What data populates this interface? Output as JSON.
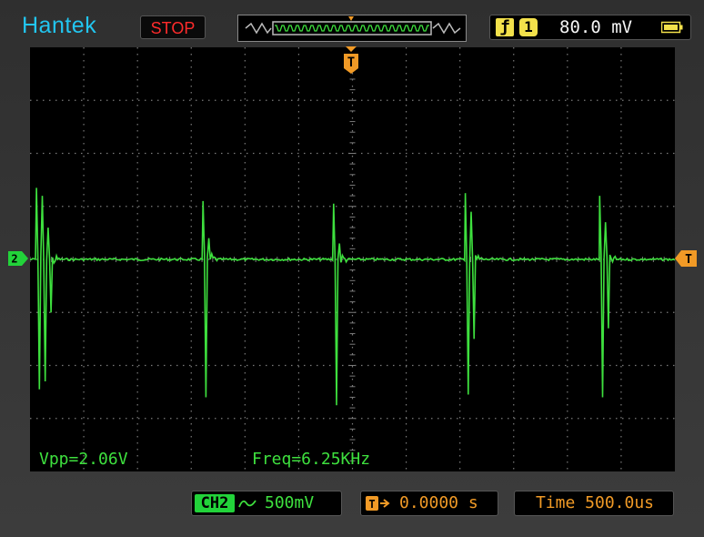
{
  "header": {
    "brand": "Hantek",
    "run_state": "STOP",
    "trigger": {
      "edge_symbol": "ƒ",
      "source": "1",
      "level": "80.0 mV",
      "battery_icon": "battery-icon"
    }
  },
  "screen": {
    "measurements": {
      "vpp": "Vpp=2.06V",
      "freq": "Freq=6.25KHz"
    },
    "channel_marker": "2",
    "trigger_level_marker": "T",
    "trigger_position_marker": "T"
  },
  "status_bar": {
    "channel": {
      "label": "CH2",
      "coupling_icon": "ac-coupling-icon",
      "scale": "500mV"
    },
    "trigger_offset": {
      "icon": "trigger-offset-icon",
      "value": "0.0000 s"
    },
    "timebase": "Time 500.0us"
  },
  "colors": {
    "trace": "#3ee03e",
    "brand": "#22c6f0",
    "stop": "#ff2b2b",
    "trigger": "#f19a26",
    "grid": "#7a7a7a"
  },
  "chart_data": {
    "type": "line",
    "grid": true,
    "divisions": {
      "x": 12,
      "y": 8
    },
    "baseline_div": 0,
    "series": [
      {
        "values_note_free": true,
        "bursts": [
          {
            "x_div": 0.12,
            "peaks": [
              1.35,
              -2.45,
              1.2,
              -2.3,
              0.6,
              -1.0
            ]
          },
          {
            "x_div": 3.22,
            "peaks": [
              1.1,
              -2.6,
              0.4
            ]
          },
          {
            "x_div": 5.65,
            "peaks": [
              1.05,
              -2.75,
              0.3
            ]
          },
          {
            "x_div": 8.1,
            "peaks": [
              1.25,
              -2.55,
              0.9,
              -1.5
            ]
          },
          {
            "x_div": 10.6,
            "peaks": [
              1.2,
              -2.6,
              0.7,
              -1.3
            ]
          }
        ]
      }
    ]
  }
}
